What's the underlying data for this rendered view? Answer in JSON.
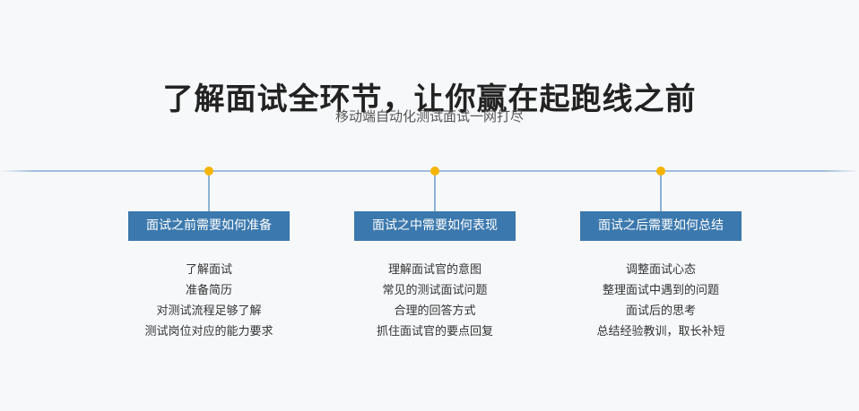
{
  "header": {
    "title": "了解面试全环节，让你赢在起跑线之前",
    "subtitle": "移动端自动化测试面试一网打尽"
  },
  "colors": {
    "accent": "#3b78ad",
    "dot": "#f5b400",
    "line": "#9fbedb",
    "background": "#f7f8fa"
  },
  "stages": [
    {
      "label": "面试之前需要如何准备",
      "items": [
        "了解面试",
        "准备简历",
        "对测试流程足够了解",
        "测试岗位对应的能力要求"
      ]
    },
    {
      "label": "面试之中需要如何表现",
      "items": [
        "理解面试官的意图",
        "常见的测试面试问题",
        "合理的回答方式",
        "抓住面试官的要点回复"
      ]
    },
    {
      "label": "面试之后需要如何总结",
      "items": [
        "调整面试心态",
        "整理面试中遇到的问题",
        "面试后的思考",
        "总结经验教训，取长补短"
      ]
    }
  ]
}
